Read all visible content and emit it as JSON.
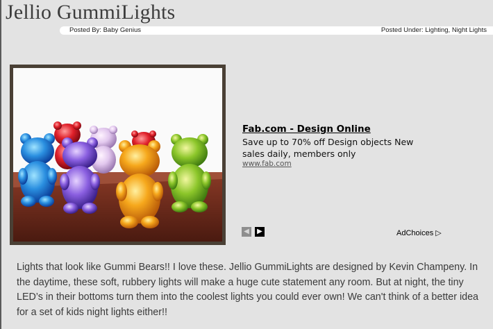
{
  "post": {
    "title": "Jellio GummiLights",
    "posted_by": "Posted By: Baby Genius",
    "posted_under": "Posted Under: Lighting, Night Lights",
    "body": "Lights that look like Gummi Bears!! I love these. Jellio GummiLights are designed by Kevin Champeny. In the daytime, these soft, rubbery lights will make a huge cute statement any room. But at night, the tiny LED’s in their bottoms turn them into the coolest lights you could ever own! We can't think of a better idea for a set of kids night lights either!!"
  },
  "ad": {
    "title": "Fab.com - Design Online",
    "description": "Save up to 70% off Design objects New sales daily, members only",
    "url": "www.fab.com",
    "prev_icon": "chevron-left-icon",
    "next_icon": "chevron-right-icon",
    "choices_label": "AdChoices",
    "choices_icon": "play-outline-icon"
  },
  "colors": {
    "page_background": "#e3e3e3",
    "frame": "#4a4035",
    "title_text": "#3c3c3c",
    "body_text": "#3a3a3a"
  }
}
